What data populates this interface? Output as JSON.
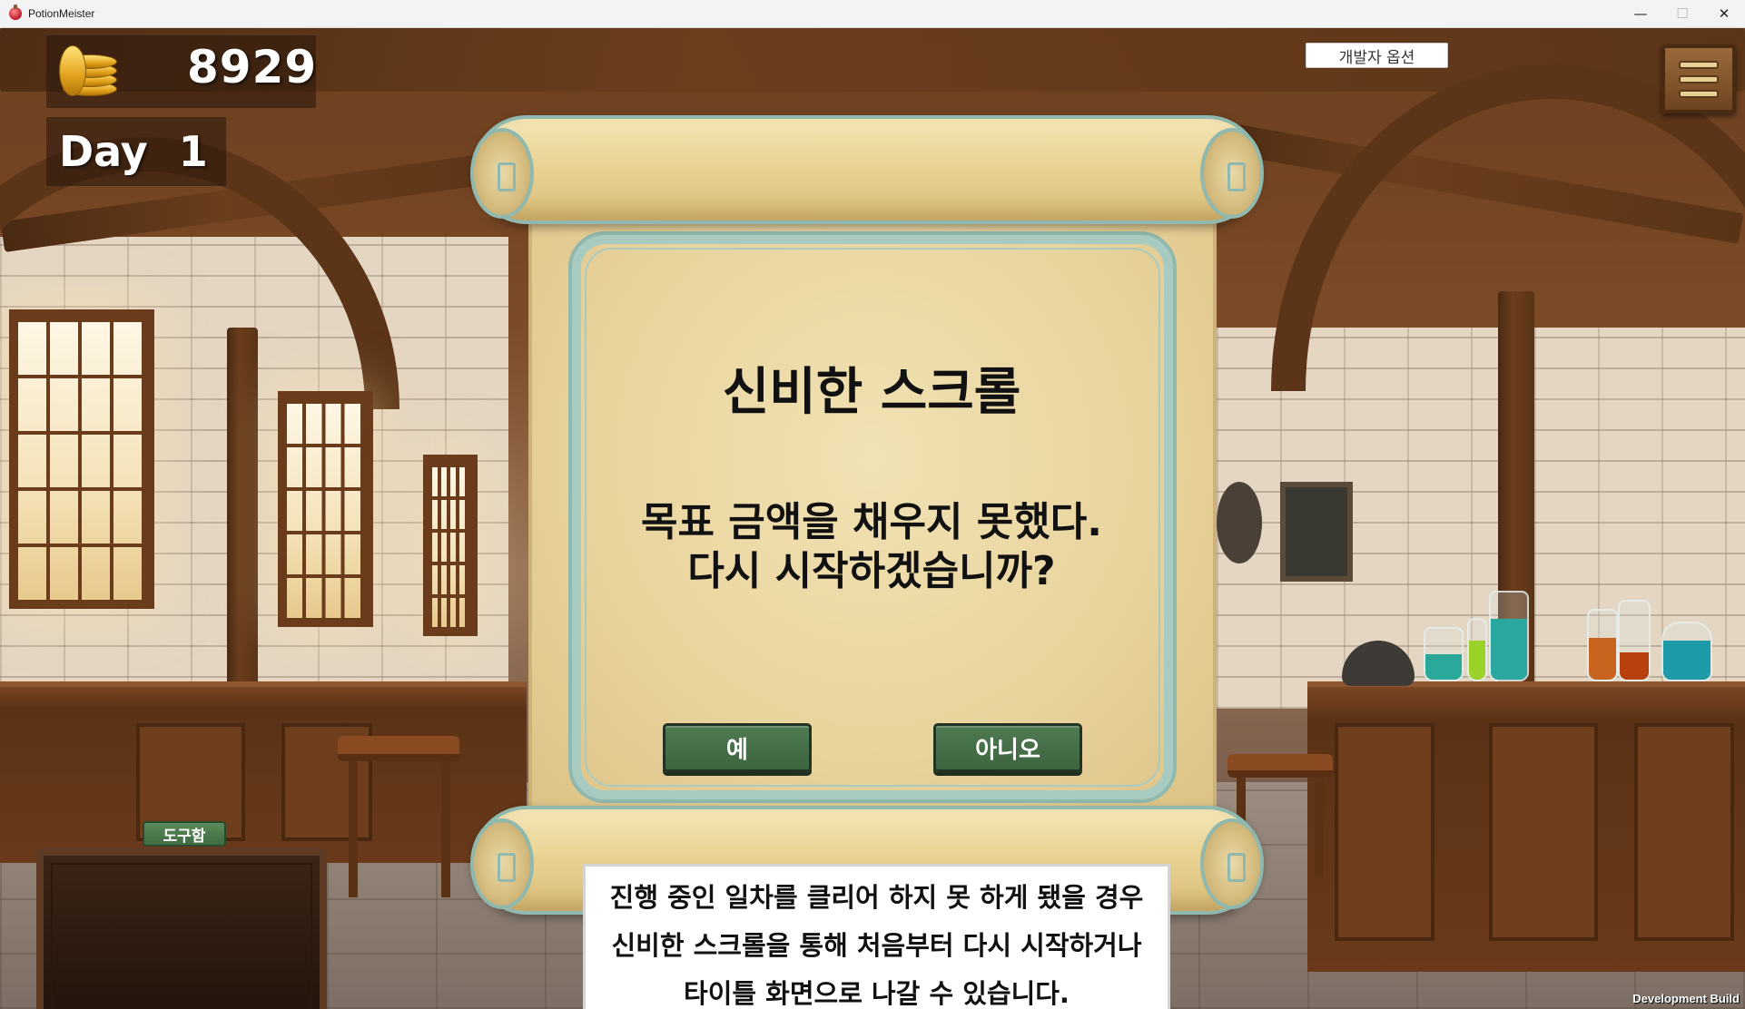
{
  "window": {
    "title": "PotionMeister",
    "controls": {
      "minimize": "—",
      "maximize": "☐",
      "close": "✕"
    }
  },
  "hud": {
    "gold": "8929",
    "day_label": "Day",
    "day_number": "1",
    "dev_options_label": "개발자 옵션",
    "menu_icon": "hamburger-menu-icon"
  },
  "inventory": {
    "label": "도구함"
  },
  "dialog": {
    "title": "신비한 스크롤",
    "message_line1": "목표 금액을 채우지 못했다.",
    "message_line2": "다시 시작하겠습니까?",
    "yes_label": "예",
    "no_label": "아니오"
  },
  "tip": {
    "line1": "진행 중인 일차를 클리어 하지 못 하게 됐을 경우",
    "line2": "신비한 스크롤을 통해 처음부터 다시 시작하거나",
    "line3": "타이틀 화면으로 나갈 수 있습니다."
  },
  "footer": {
    "build_label": "Development Build"
  },
  "colors": {
    "button_green": "#4f7a52",
    "scroll_border": "#8fb8ae",
    "parchment": "#e8d39c"
  }
}
